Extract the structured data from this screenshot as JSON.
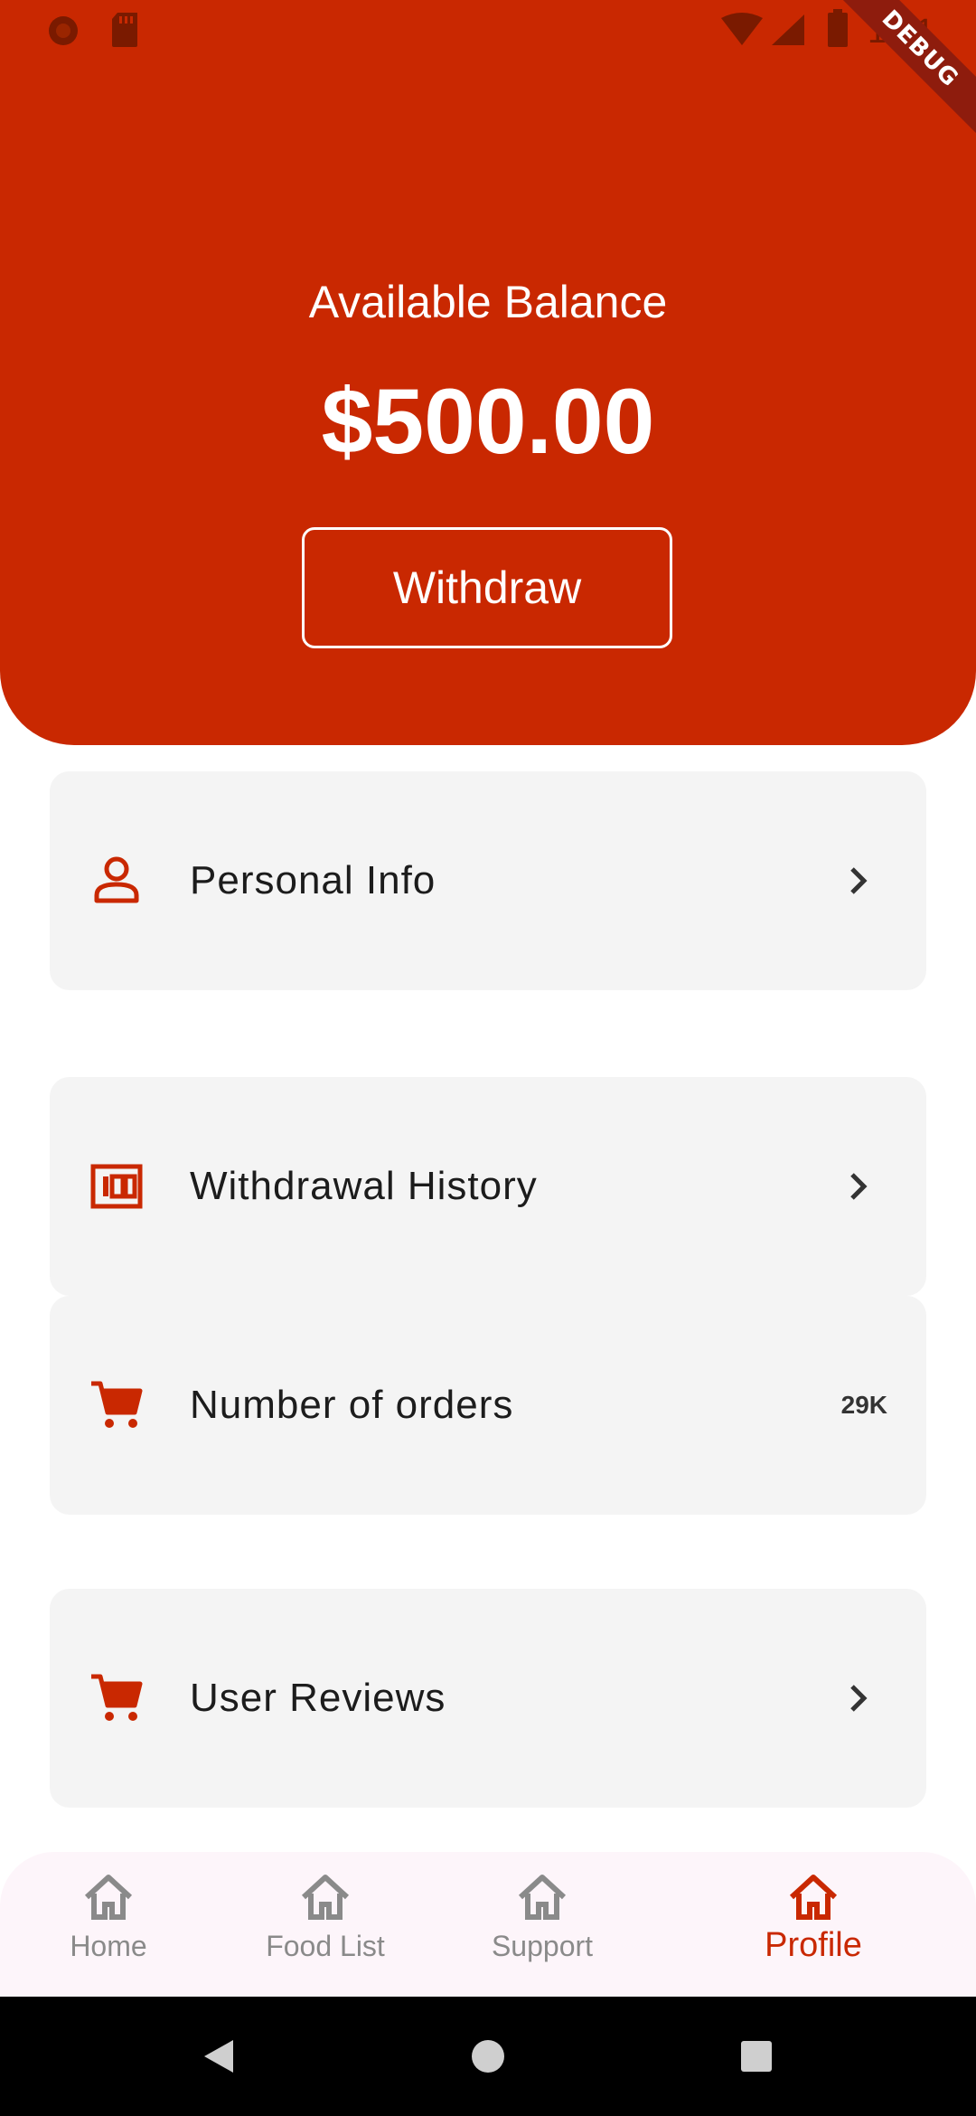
{
  "status_bar": {
    "time": "1:21",
    "debug_label": "DEBUG",
    "icons": [
      "record-icon",
      "sd-card-icon",
      "wifi-icon",
      "signal-icon",
      "battery-icon"
    ]
  },
  "balance": {
    "label": "Available Balance",
    "amount": "$500.00",
    "withdraw_label": "Withdraw"
  },
  "menu": {
    "items": [
      {
        "label": "Personal Info",
        "icon": "person-icon",
        "trailing": "chevron"
      },
      {
        "label": "Withdrawal History",
        "icon": "money-icon",
        "trailing": "chevron"
      },
      {
        "label": "Number of orders",
        "icon": "cart-icon",
        "value": "29K"
      },
      {
        "label": "User Reviews",
        "icon": "cart-icon",
        "trailing": "chevron"
      }
    ]
  },
  "bottom_nav": {
    "items": [
      {
        "label": "Home",
        "icon": "home-icon",
        "active": false
      },
      {
        "label": "Food List",
        "icon": "home-icon",
        "active": false
      },
      {
        "label": "Support",
        "icon": "home-icon",
        "active": false
      },
      {
        "label": "Profile",
        "icon": "home-icon",
        "active": true
      }
    ]
  },
  "colors": {
    "accent": "#C92801",
    "card_bg": "#F4F4F4",
    "nav_bg": "#FDF5FA",
    "inactive": "#8a8a8a"
  }
}
